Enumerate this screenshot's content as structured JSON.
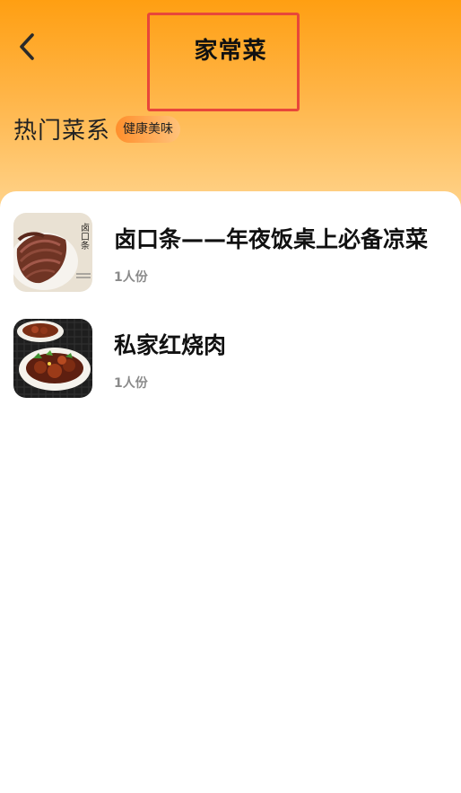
{
  "header": {
    "title": "家常菜",
    "back_icon": "chevron-left-icon"
  },
  "section": {
    "title": "热门菜系",
    "tag": "健康美味"
  },
  "recipes": [
    {
      "name": "卤口条——年夜饭桌上必备凉菜",
      "servings": "1人份",
      "image_caption": "卤口条"
    },
    {
      "name": "私家红烧肉",
      "servings": "1人份"
    }
  ],
  "colors": {
    "header_top": "#ff9f12",
    "header_bottom": "#ffd58f",
    "highlight_border": "#e8473a",
    "tag_start": "#ff8f2c",
    "tag_end": "#ffc27a",
    "muted_text": "#8a8a8a"
  }
}
